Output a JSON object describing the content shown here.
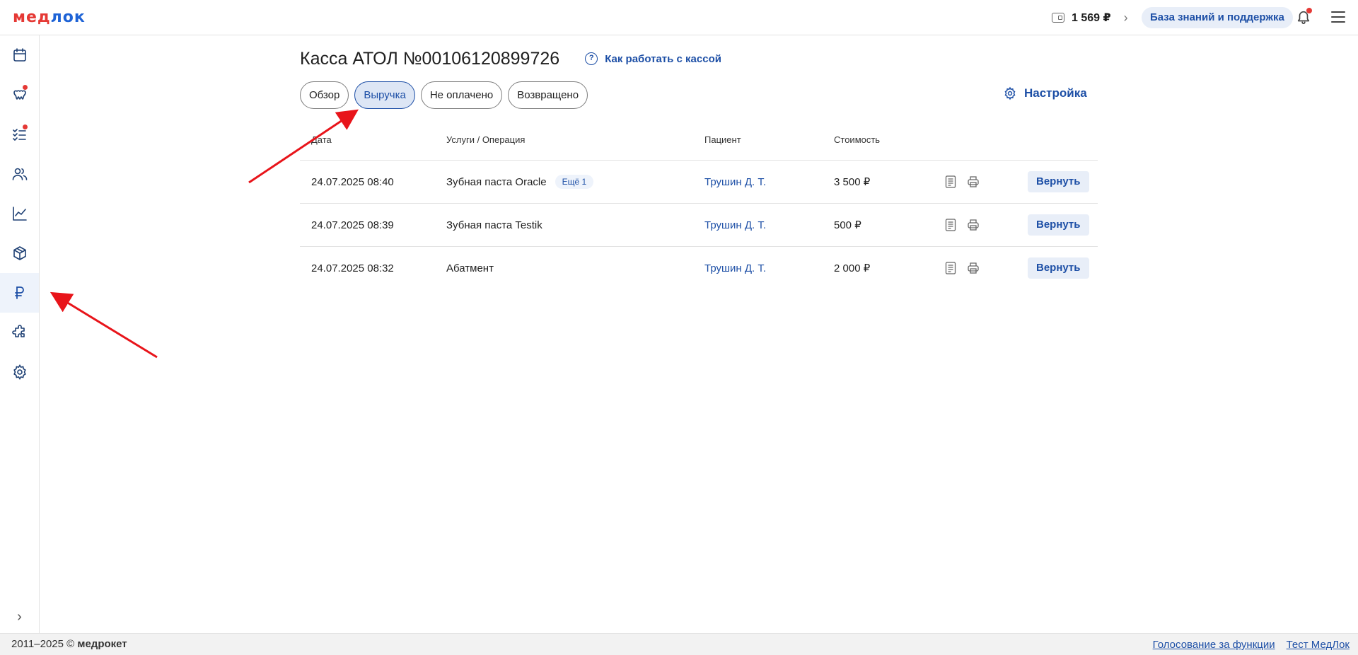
{
  "header": {
    "logo_part1": "мед",
    "logo_part2": "лок",
    "balance": "1 569 ₽",
    "knowledge_base_label": "База знаний и поддержка"
  },
  "sidebar": {
    "items": [
      {
        "name": "calendar-icon"
      },
      {
        "name": "tooth-icon",
        "notification": true
      },
      {
        "name": "checklist-icon",
        "notification": true
      },
      {
        "name": "users-icon"
      },
      {
        "name": "chart-icon"
      },
      {
        "name": "box-icon"
      },
      {
        "name": "ruble-icon",
        "active": true
      },
      {
        "name": "puzzle-icon"
      },
      {
        "name": "gear-icon"
      }
    ]
  },
  "page": {
    "title": "Касса АТОЛ №00106120899726",
    "help_label": "Как работать с кассой",
    "settings_label": "Настройка"
  },
  "tabs": [
    {
      "label": "Обзор",
      "active": false
    },
    {
      "label": "Выручка",
      "active": true
    },
    {
      "label": "Не оплачено",
      "active": false
    },
    {
      "label": "Возвращено",
      "active": false
    }
  ],
  "table": {
    "headers": {
      "date": "Дата",
      "service": "Услуги / Операция",
      "patient": "Пациент",
      "cost": "Стоимость"
    },
    "rows": [
      {
        "date": "24.07.2025 08:40",
        "service": "Зубная паста Oracle",
        "badge": "Ещё 1",
        "patient": "Трушин Д. Т.",
        "cost": "3 500 ₽",
        "action": "Вернуть"
      },
      {
        "date": "24.07.2025 08:39",
        "service": "Зубная паста Testik",
        "badge": "",
        "patient": "Трушин Д. Т.",
        "cost": "500 ₽",
        "action": "Вернуть"
      },
      {
        "date": "24.07.2025 08:32",
        "service": "Абатмент",
        "badge": "",
        "patient": "Трушин Д. Т.",
        "cost": "2 000 ₽",
        "action": "Вернуть"
      }
    ]
  },
  "footer": {
    "copyright_years": "2011–2025 ©",
    "copyright_brand": "медрокет",
    "link_vote": "Голосование за функции",
    "link_test": "Тест МедЛок"
  },
  "colors": {
    "accent": "#1d4fa6",
    "logo_red": "#e53935",
    "arrow_red": "#e8141a"
  }
}
